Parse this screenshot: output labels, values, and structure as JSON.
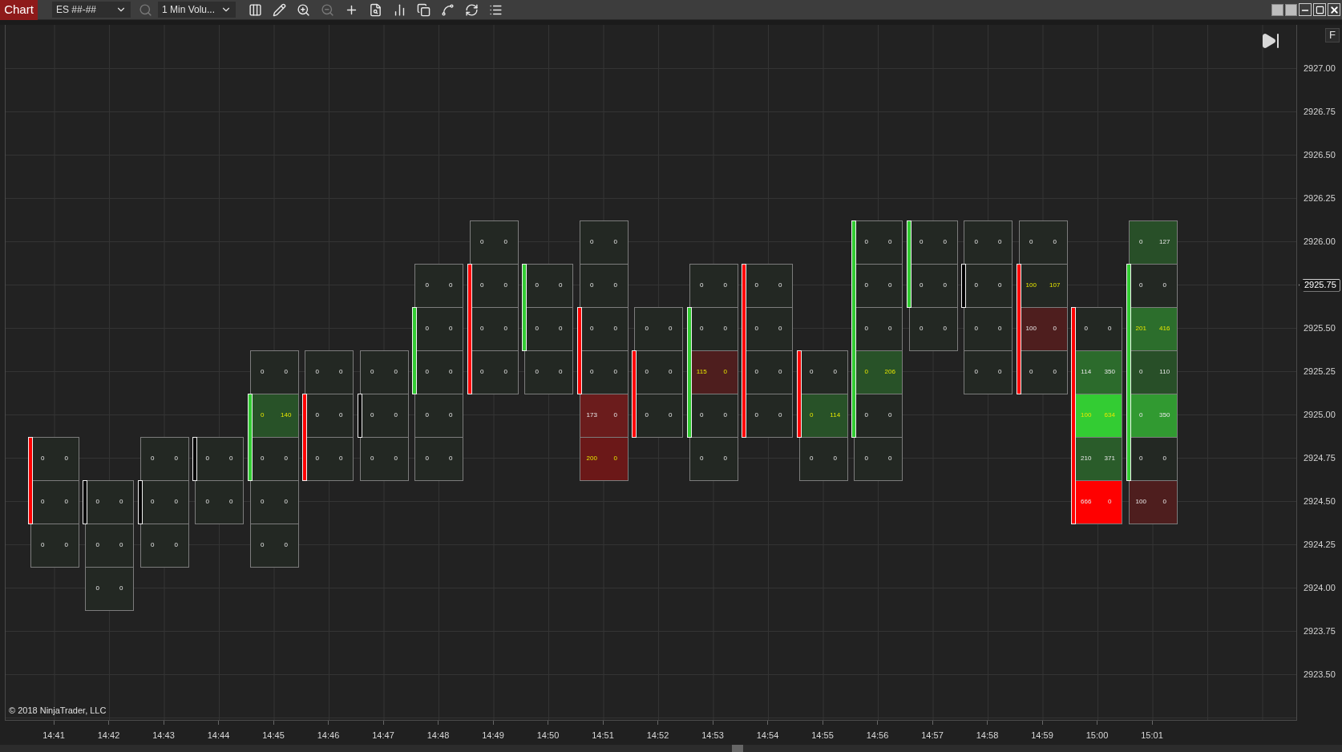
{
  "toolbar": {
    "title": "Chart",
    "instrument": "ES ##-##",
    "interval": "1 Min Volu..."
  },
  "indicator_letter": "F",
  "price_axis": [
    {
      "text": "2927.00",
      "current": false
    },
    {
      "text": "2926.75",
      "current": false
    },
    {
      "text": "2926.50",
      "current": false
    },
    {
      "text": "2926.25",
      "current": false
    },
    {
      "text": "2926.00",
      "current": false
    },
    {
      "text": "2925.75",
      "current": true
    },
    {
      "text": "2925.50",
      "current": false
    },
    {
      "text": "2925.25",
      "current": false
    },
    {
      "text": "2925.00",
      "current": false
    },
    {
      "text": "2924.75",
      "current": false
    },
    {
      "text": "2924.50",
      "current": false
    },
    {
      "text": "2924.25",
      "current": false
    },
    {
      "text": "2924.00",
      "current": false
    },
    {
      "text": "2923.75",
      "current": false
    },
    {
      "text": "2923.50",
      "current": false
    }
  ],
  "copyright": "© 2018 NinjaTrader, LLC",
  "bars": [
    {
      "time": "14:41",
      "color": "#ff0000",
      "cells": [
        null,
        null,
        null,
        null,
        null,
        null,
        null,
        null,
        null,
        {
          "bid": "0",
          "ask": "0",
          "color": "#232823",
          "imbalance": false,
          "body": true
        },
        {
          "bid": "0",
          "ask": "0",
          "color": "#232823",
          "imbalance": false,
          "body": true
        },
        {
          "bid": "0",
          "ask": "0",
          "color": "#232823",
          "imbalance": false,
          "body": false
        }
      ]
    },
    {
      "time": "14:42",
      "color": "#000000",
      "cells": [
        null,
        null,
        null,
        null,
        null,
        null,
        null,
        null,
        null,
        null,
        {
          "bid": "0",
          "ask": "0",
          "color": "#232823",
          "imbalance": false,
          "body": true
        },
        {
          "bid": "0",
          "ask": "0",
          "color": "#232823",
          "imbalance": false,
          "body": false
        },
        {
          "bid": "0",
          "ask": "0",
          "color": "#232823",
          "imbalance": false,
          "body": false
        }
      ]
    },
    {
      "time": "14:43",
      "color": "#000000",
      "cells": [
        null,
        null,
        null,
        null,
        null,
        null,
        null,
        null,
        null,
        {
          "bid": "0",
          "ask": "0",
          "color": "#232823",
          "imbalance": false,
          "body": false
        },
        {
          "bid": "0",
          "ask": "0",
          "color": "#232823",
          "imbalance": false,
          "body": true
        },
        {
          "bid": "0",
          "ask": "0",
          "color": "#232823",
          "imbalance": false,
          "body": false
        }
      ]
    },
    {
      "time": "14:44",
      "color": "#000000",
      "cells": [
        null,
        null,
        null,
        null,
        null,
        null,
        null,
        null,
        null,
        {
          "bid": "0",
          "ask": "0",
          "color": "#232823",
          "imbalance": false,
          "body": true
        },
        {
          "bid": "0",
          "ask": "0",
          "color": "#232823",
          "imbalance": false,
          "body": false
        }
      ]
    },
    {
      "time": "14:45",
      "color": "#33cc33",
      "cells": [
        null,
        null,
        null,
        null,
        null,
        null,
        null,
        {
          "bid": "0",
          "ask": "0",
          "color": "#232823",
          "imbalance": false,
          "body": false
        },
        {
          "bid": "0",
          "ask": "140",
          "color": "#285228",
          "imbalance": true,
          "body": true
        },
        {
          "bid": "0",
          "ask": "0",
          "color": "#232823",
          "imbalance": false,
          "body": true
        },
        {
          "bid": "0",
          "ask": "0",
          "color": "#232823",
          "imbalance": false,
          "body": false
        },
        {
          "bid": "0",
          "ask": "0",
          "color": "#232823",
          "imbalance": false,
          "body": false
        }
      ]
    },
    {
      "time": "14:46",
      "color": "#ff0000",
      "cells": [
        null,
        null,
        null,
        null,
        null,
        null,
        null,
        {
          "bid": "0",
          "ask": "0",
          "color": "#232823",
          "imbalance": false,
          "body": false
        },
        {
          "bid": "0",
          "ask": "0",
          "color": "#232823",
          "imbalance": false,
          "body": true
        },
        {
          "bid": "0",
          "ask": "0",
          "color": "#232823",
          "imbalance": false,
          "body": true
        }
      ]
    },
    {
      "time": "14:47",
      "color": "#000000",
      "cells": [
        null,
        null,
        null,
        null,
        null,
        null,
        null,
        {
          "bid": "0",
          "ask": "0",
          "color": "#232823",
          "imbalance": false,
          "body": false
        },
        {
          "bid": "0",
          "ask": "0",
          "color": "#232823",
          "imbalance": false,
          "body": true
        },
        {
          "bid": "0",
          "ask": "0",
          "color": "#232823",
          "imbalance": false,
          "body": false
        }
      ]
    },
    {
      "time": "14:48",
      "color": "#33cc33",
      "cells": [
        null,
        null,
        null,
        null,
        null,
        {
          "bid": "0",
          "ask": "0",
          "color": "#232823",
          "imbalance": false,
          "body": false
        },
        {
          "bid": "0",
          "ask": "0",
          "color": "#232823",
          "imbalance": false,
          "body": true
        },
        {
          "bid": "0",
          "ask": "0",
          "color": "#232823",
          "imbalance": false,
          "body": true
        },
        {
          "bid": "0",
          "ask": "0",
          "color": "#232823",
          "imbalance": false,
          "body": false
        },
        {
          "bid": "0",
          "ask": "0",
          "color": "#232823",
          "imbalance": false,
          "body": false
        }
      ]
    },
    {
      "time": "14:49",
      "color": "#ff0000",
      "cells": [
        null,
        null,
        null,
        null,
        {
          "bid": "0",
          "ask": "0",
          "color": "#232823",
          "imbalance": false,
          "body": false
        },
        {
          "bid": "0",
          "ask": "0",
          "color": "#232823",
          "imbalance": false,
          "body": true
        },
        {
          "bid": "0",
          "ask": "0",
          "color": "#232823",
          "imbalance": false,
          "body": true
        },
        {
          "bid": "0",
          "ask": "0",
          "color": "#232823",
          "imbalance": false,
          "body": true
        }
      ]
    },
    {
      "time": "14:50",
      "color": "#33cc33",
      "cells": [
        null,
        null,
        null,
        null,
        null,
        {
          "bid": "0",
          "ask": "0",
          "color": "#232823",
          "imbalance": false,
          "body": true
        },
        {
          "bid": "0",
          "ask": "0",
          "color": "#232823",
          "imbalance": false,
          "body": true
        },
        {
          "bid": "0",
          "ask": "0",
          "color": "#232823",
          "imbalance": false,
          "body": false
        }
      ]
    },
    {
      "time": "14:51",
      "color": "#ff0000",
      "cells": [
        null,
        null,
        null,
        null,
        {
          "bid": "0",
          "ask": "0",
          "color": "#232823",
          "imbalance": false,
          "body": false
        },
        {
          "bid": "0",
          "ask": "0",
          "color": "#232823",
          "imbalance": false,
          "body": false
        },
        {
          "bid": "0",
          "ask": "0",
          "color": "#232823",
          "imbalance": false,
          "body": true
        },
        {
          "bid": "0",
          "ask": "0",
          "color": "#232823",
          "imbalance": false,
          "body": true
        },
        {
          "bid": "173",
          "ask": "0",
          "color": "#6b1c1c",
          "imbalance": false,
          "body": false
        },
        {
          "bid": "200",
          "ask": "0",
          "color": "#6b1818",
          "imbalance": true,
          "body": false
        }
      ]
    },
    {
      "time": "14:52",
      "color": "#ff0000",
      "cells": [
        null,
        null,
        null,
        null,
        null,
        null,
        {
          "bid": "0",
          "ask": "0",
          "color": "#232823",
          "imbalance": false,
          "body": false
        },
        {
          "bid": "0",
          "ask": "0",
          "color": "#232823",
          "imbalance": false,
          "body": true
        },
        {
          "bid": "0",
          "ask": "0",
          "color": "#232823",
          "imbalance": false,
          "body": true
        }
      ]
    },
    {
      "time": "14:53",
      "color": "#33cc33",
      "cells": [
        null,
        null,
        null,
        null,
        null,
        {
          "bid": "0",
          "ask": "0",
          "color": "#232823",
          "imbalance": false,
          "body": false
        },
        {
          "bid": "0",
          "ask": "0",
          "color": "#232823",
          "imbalance": false,
          "body": true
        },
        {
          "bid": "115",
          "ask": "0",
          "color": "#4e1e1e",
          "imbalance": true,
          "body": true
        },
        {
          "bid": "0",
          "ask": "0",
          "color": "#232823",
          "imbalance": false,
          "body": true
        },
        {
          "bid": "0",
          "ask": "0",
          "color": "#232823",
          "imbalance": false,
          "body": false
        }
      ]
    },
    {
      "time": "14:54",
      "color": "#ff0000",
      "cells": [
        null,
        null,
        null,
        null,
        null,
        {
          "bid": "0",
          "ask": "0",
          "color": "#232823",
          "imbalance": false,
          "body": true
        },
        {
          "bid": "0",
          "ask": "0",
          "color": "#232823",
          "imbalance": false,
          "body": true
        },
        {
          "bid": "0",
          "ask": "0",
          "color": "#232823",
          "imbalance": false,
          "body": true
        },
        {
          "bid": "0",
          "ask": "0",
          "color": "#232823",
          "imbalance": false,
          "body": true
        }
      ]
    },
    {
      "time": "14:55",
      "color": "#ff0000",
      "cells": [
        null,
        null,
        null,
        null,
        null,
        null,
        null,
        {
          "bid": "0",
          "ask": "0",
          "color": "#232823",
          "imbalance": false,
          "body": true
        },
        {
          "bid": "0",
          "ask": "114",
          "color": "#285228",
          "imbalance": true,
          "body": true
        },
        {
          "bid": "0",
          "ask": "0",
          "color": "#232823",
          "imbalance": false,
          "body": false
        }
      ]
    },
    {
      "time": "14:56",
      "color": "#33cc33",
      "cells": [
        null,
        null,
        null,
        null,
        {
          "bid": "0",
          "ask": "0",
          "color": "#232823",
          "imbalance": false,
          "body": true
        },
        {
          "bid": "0",
          "ask": "0",
          "color": "#232823",
          "imbalance": false,
          "body": true
        },
        {
          "bid": "0",
          "ask": "0",
          "color": "#232823",
          "imbalance": false,
          "body": true
        },
        {
          "bid": "0",
          "ask": "206",
          "color": "#285228",
          "imbalance": true,
          "body": true
        },
        {
          "bid": "0",
          "ask": "0",
          "color": "#232823",
          "imbalance": false,
          "body": true
        },
        {
          "bid": "0",
          "ask": "0",
          "color": "#232823",
          "imbalance": false,
          "body": false
        }
      ]
    },
    {
      "time": "14:57",
      "color": "#33cc33",
      "cells": [
        null,
        null,
        null,
        null,
        {
          "bid": "0",
          "ask": "0",
          "color": "#232823",
          "imbalance": false,
          "body": true
        },
        {
          "bid": "0",
          "ask": "0",
          "color": "#232823",
          "imbalance": false,
          "body": true
        },
        {
          "bid": "0",
          "ask": "0",
          "color": "#232823",
          "imbalance": false,
          "body": false
        }
      ]
    },
    {
      "time": "14:58",
      "color": "#000000",
      "cells": [
        null,
        null,
        null,
        null,
        {
          "bid": "0",
          "ask": "0",
          "color": "#232823",
          "imbalance": false,
          "body": false
        },
        {
          "bid": "0",
          "ask": "0",
          "color": "#232823",
          "imbalance": false,
          "body": true
        },
        {
          "bid": "0",
          "ask": "0",
          "color": "#232823",
          "imbalance": false,
          "body": false
        },
        {
          "bid": "0",
          "ask": "0",
          "color": "#232823",
          "imbalance": false,
          "body": false
        }
      ]
    },
    {
      "time": "14:59",
      "color": "#ff0000",
      "cells": [
        null,
        null,
        null,
        null,
        {
          "bid": "0",
          "ask": "0",
          "color": "#232823",
          "imbalance": false,
          "body": false
        },
        {
          "bid": "100",
          "ask": "107",
          "color": "#232823",
          "imbalance": true,
          "body": true
        },
        {
          "bid": "100",
          "ask": "0",
          "color": "#4e1e1e",
          "imbalance": false,
          "body": true
        },
        {
          "bid": "0",
          "ask": "0",
          "color": "#232823",
          "imbalance": false,
          "body": true
        }
      ]
    },
    {
      "time": "15:00",
      "color": "#ff0000",
      "cells": [
        null,
        null,
        null,
        null,
        null,
        null,
        {
          "bid": "0",
          "ask": "0",
          "color": "#232823",
          "imbalance": false,
          "body": true
        },
        {
          "bid": "114",
          "ask": "350",
          "color": "#2c6b2c",
          "imbalance": false,
          "body": true
        },
        {
          "bid": "100",
          "ask": "634",
          "color": "#33cc33",
          "imbalance": true,
          "body": true
        },
        {
          "bid": "210",
          "ask": "371",
          "color": "#2a5c2a",
          "imbalance": false,
          "body": true
        },
        {
          "bid": "666",
          "ask": "0",
          "color": "#ff0000",
          "imbalance": false,
          "body": true
        }
      ]
    },
    {
      "time": "15:01",
      "color": "#33cc33",
      "cells": [
        null,
        null,
        null,
        null,
        {
          "bid": "0",
          "ask": "127",
          "color": "#284f28",
          "imbalance": false,
          "body": false
        },
        {
          "bid": "0",
          "ask": "0",
          "color": "#232823",
          "imbalance": false,
          "body": true
        },
        {
          "bid": "201",
          "ask": "416",
          "color": "#2c6e2c",
          "imbalance": true,
          "body": true
        },
        {
          "bid": "0",
          "ask": "110",
          "color": "#284f28",
          "imbalance": false,
          "body": true
        },
        {
          "bid": "0",
          "ask": "350",
          "color": "#319a31",
          "imbalance": false,
          "body": true
        },
        {
          "bid": "0",
          "ask": "0",
          "color": "#232823",
          "imbalance": false,
          "body": true
        },
        {
          "bid": "100",
          "ask": "0",
          "color": "#4e1e1e",
          "imbalance": false,
          "body": false
        }
      ]
    }
  ]
}
